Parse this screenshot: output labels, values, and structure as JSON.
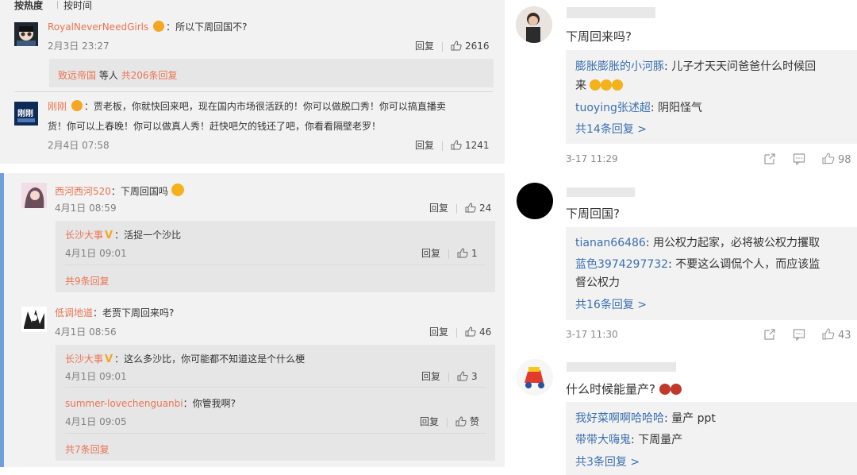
{
  "top_panel": {
    "sort_hot": "按热度",
    "sort_time": "按时间",
    "c1": {
      "user": "RoyalNeverNeedGirls",
      "text": "所以下周回国不?",
      "time": "2月3日 23:27",
      "reply": "回复",
      "likes": "2616"
    },
    "c1_sub": {
      "user": "致远帝国",
      "mid": " 等人 ",
      "total": "共206条回复"
    },
    "c2": {
      "user": "刚刚",
      "text1": "：贾老板，你就快回来吧，现在国内市场很活跃的！你可以做脱口秀！你可以搞直播卖",
      "text2": "货！你可以上春晚！你可以做真人秀！赶快吧欠的钱还了吧，你看看隔壁老罗！",
      "time": "2月4日 07:58",
      "reply": "回复",
      "likes": "1241"
    }
  },
  "mid_panel": {
    "c1": {
      "user": "西河西河520",
      "text": "：下周回国吗",
      "time": "4月1日 08:59",
      "reply": "回复",
      "likes": "24"
    },
    "c1_r1": {
      "user": "长沙大事",
      "text": "：活捉一个沙比",
      "time": "4月1日 09:01",
      "reply": "回复",
      "likes": "1"
    },
    "c1_total": "共9条回复",
    "c2": {
      "user": "低调地道",
      "text": "：老贾下周回来吗?",
      "time": "4月1日 08:56",
      "reply": "回复",
      "likes": "46"
    },
    "c2_r1": {
      "user": "长沙大事",
      "text": "：这么多沙比，你可能都不知道这是个什么梗",
      "time": "4月1日 09:01",
      "reply": "回复",
      "likes": "3"
    },
    "c2_r2": {
      "user": "summer-lovechenguanbi",
      "text": "：你管我啊?",
      "time": "4月1日 09:05",
      "reply": "回复",
      "likes": "赞"
    },
    "c2_total": "共7条回复"
  },
  "right_panel": {
    "c1": {
      "text": "下周回来吗?",
      "r1_user": "膨胀膨胀的小河豚",
      "r1_text1": ": 儿子才天天问爸爸什么时候回",
      "r1_text2": "来",
      "r2_user": "tuoying张述超",
      "r2_text": ": 阴阳怪气",
      "total": "共14条回复 >",
      "time": "3-17 11:29",
      "likes": "98"
    },
    "c2": {
      "text": "下周回国?",
      "r1_user": "tianan66486",
      "r1_text": ": 用公权力起家，必将被公权力攫取",
      "r2_user": "蓝色3974297732",
      "r2_text1": ": 不要这么调侃个人，而应该监",
      "r2_text2": "督公权力",
      "total": "共16条回复 >",
      "time": "3-17 11:30",
      "likes": "43"
    },
    "c3": {
      "text": "什么时候能量产?",
      "r1_user": "我好菜啊啊哈哈哈",
      "r1_text": ": 量产 ppt",
      "r2_user": "带带大嗨鬼",
      "r2_text": ": 下周量产",
      "total": "共3条回复 >"
    }
  },
  "icons": [
    "thumb-up-icon",
    "share-icon",
    "comment-icon",
    "emoji-icon"
  ]
}
